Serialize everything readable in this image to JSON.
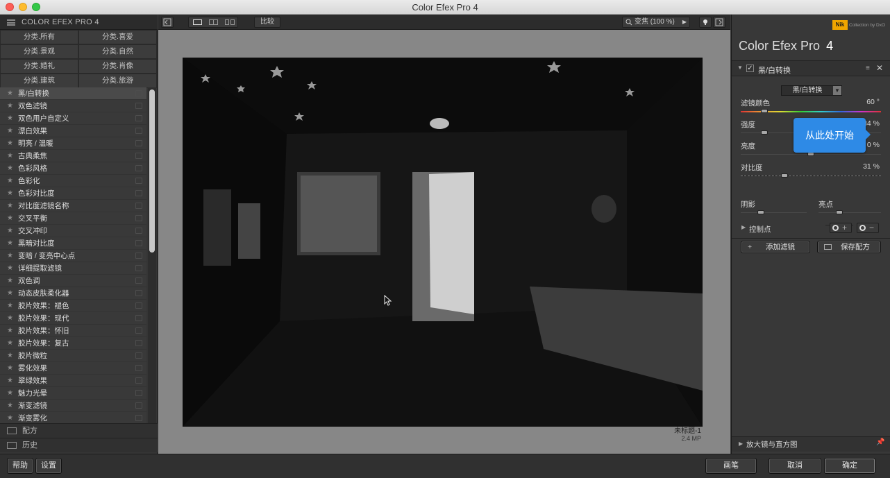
{
  "window": {
    "title": "Color Efex Pro 4"
  },
  "left_panel": {
    "title": "COLOR EFEX PRO 4",
    "categories": [
      "分类.所有",
      "分类.喜爱",
      "分类.景观",
      "分类.自然",
      "分类.婚礼",
      "分类.肖像",
      "分类.建筑",
      "分类.旅游"
    ],
    "filters": [
      "黑/白转换",
      "双色滤镜",
      "双色用户自定义",
      "漂白效果",
      "明亮 / 温暖",
      "古典柔焦",
      "色彩风格",
      "色彩化",
      "色彩对比度",
      "对比度滤镜名称",
      "交叉平衡",
      "交叉冲印",
      "黑暗对比度",
      "变暗 / 变亮中心点",
      "详细提取滤镜",
      "双色调",
      "动态皮肤柔化器",
      "胶片效果：褪色",
      "胶片效果：现代",
      "胶片效果：怀旧",
      "胶片效果：复古",
      "胶片微粒",
      "雾化效果",
      "翠绿效果",
      "魅力光晕",
      "渐变滤镜",
      "渐变雾化"
    ],
    "recipes_label": "配方",
    "history_label": "历史"
  },
  "toolbar": {
    "compare_label": "比较",
    "zoom_label": "变焦 (100 %)"
  },
  "image_info": {
    "name": "未标题-1",
    "size": "2.4 MP"
  },
  "right_panel": {
    "brand": "Nik",
    "brand_sub": "Collection by DxO",
    "app_name": "Color Efex Pro",
    "app_version": "4",
    "filter_name": "黑/白转换",
    "method_select": "黑/白转换",
    "sliders": [
      {
        "label": "滤镜颜色",
        "value": "60 °",
        "level": 0.17
      },
      {
        "label": "强度",
        "value": "34 %",
        "level": 0.17
      },
      {
        "label": "亮度",
        "value": "0 %",
        "level": 0.5
      },
      {
        "label": "对比度",
        "value": "31 %",
        "level": 0.31
      }
    ],
    "shadows_label": "阴影",
    "highlights_label": "亮点",
    "control_points_label": "控制点",
    "add_filter_label": "添加滤镜",
    "save_recipe_label": "保存配方",
    "loupe_label": "放大镜与直方图",
    "tooltip": "从此处开始"
  },
  "bottom": {
    "help": "帮助",
    "settings": "设置",
    "brush": "画笔",
    "cancel": "取消",
    "ok": "确定"
  }
}
